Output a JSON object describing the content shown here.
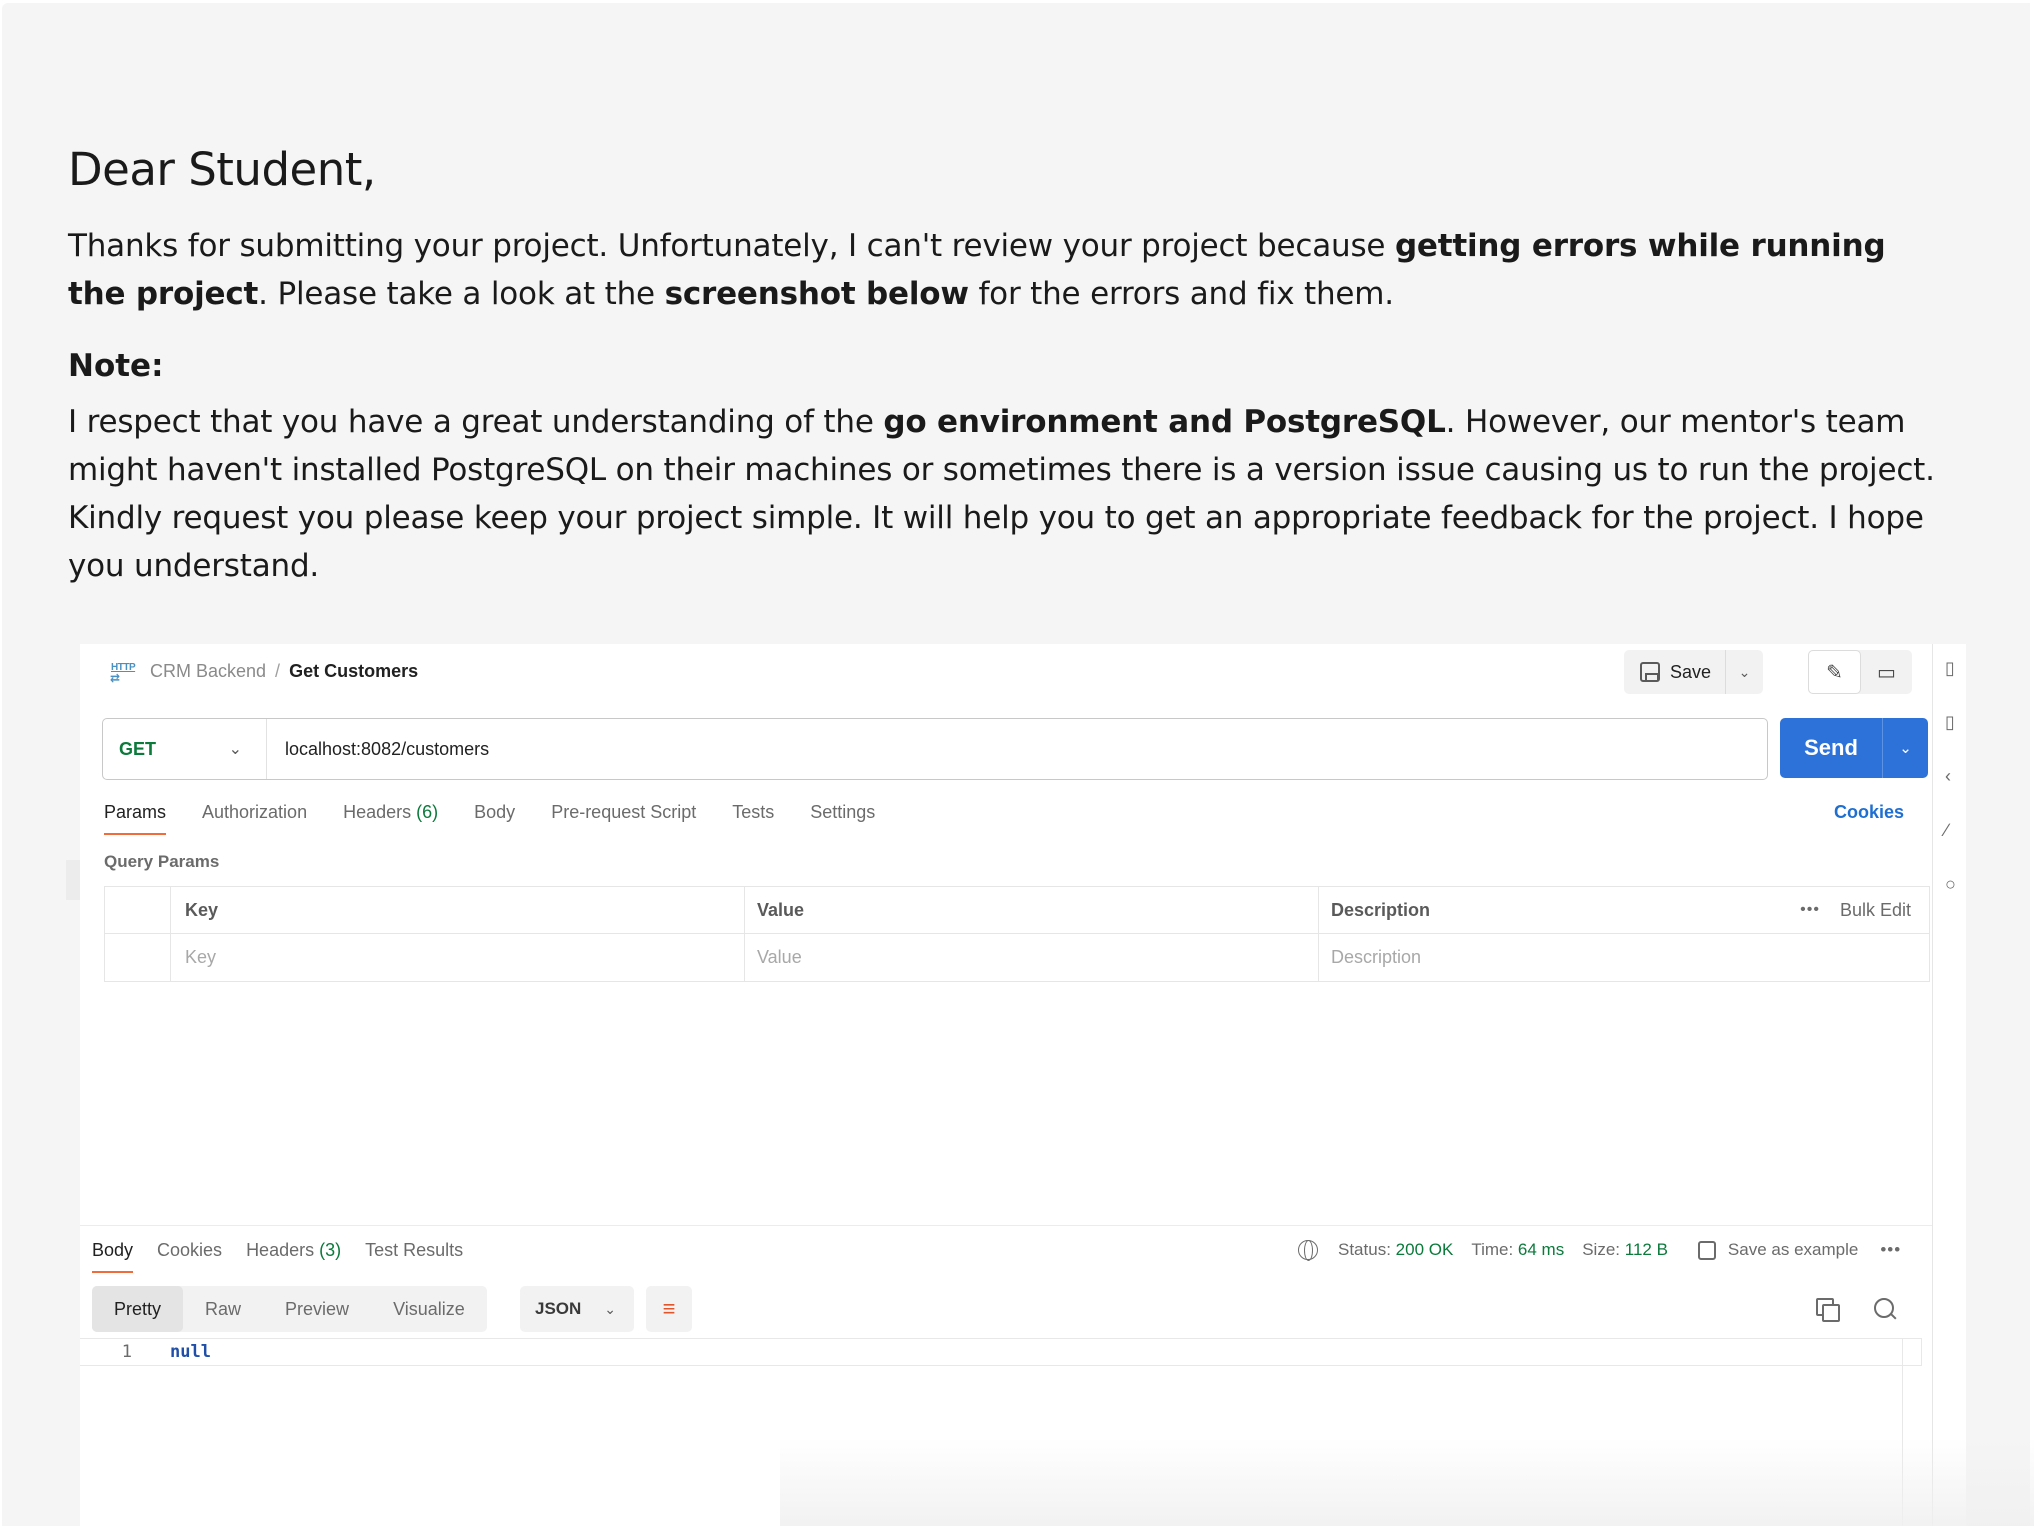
{
  "letter": {
    "greeting": "Dear Student,",
    "p1_a": "Thanks for submitting your project. Unfortunately, I can't review your project because ",
    "p1_b": "getting errors while running the project",
    "p1_c": ". Please take a look at the ",
    "p1_d": "screenshot below",
    "p1_e": " for the errors and fix them.",
    "note_heading": "Note:",
    "p2_a": "I respect that you have a great understanding of the ",
    "p2_b": "go environment and PostgreSQL",
    "p2_c": ". However, our mentor's team might haven't installed PostgreSQL on their machines or sometimes there is a version issue causing us to run the project. Kindly request you please keep your project simple. It will help you to get an appropriate feedback for the project. I hope you understand."
  },
  "postman": {
    "http_icon_label": "HTTP",
    "breadcrumb": {
      "parent": "CRM Backend",
      "separator": "/",
      "current": "Get Customers"
    },
    "save_label": "Save",
    "request": {
      "method": "GET",
      "url": "localhost:8082/customers",
      "send_label": "Send"
    },
    "request_tabs": [
      "Params",
      "Authorization",
      "Headers",
      "Body",
      "Pre-request Script",
      "Tests",
      "Settings"
    ],
    "headers_count": "(6)",
    "cookies_link": "Cookies",
    "query_params_label": "Query Params",
    "params_table": {
      "headers": {
        "key": "Key",
        "value": "Value",
        "description": "Description"
      },
      "bulk_edit": "Bulk Edit",
      "placeholder": {
        "key": "Key",
        "value": "Value",
        "description": "Description"
      }
    },
    "response_tabs": [
      "Body",
      "Cookies",
      "Headers",
      "Test Results"
    ],
    "response_headers_count": "(3)",
    "status_label": "Status:",
    "status_value": "200 OK",
    "time_label": "Time:",
    "time_value": "64 ms",
    "size_label": "Size:",
    "size_value": "112 B",
    "save_example_label": "Save as example",
    "view_modes": [
      "Pretty",
      "Raw",
      "Preview",
      "Visualize"
    ],
    "format": "JSON",
    "code": {
      "line_number": "1",
      "text": "null"
    }
  },
  "colors": {
    "accent_blue": "#2d72d9",
    "tab_underline": "#f26b3a",
    "success_green": "#0b7a3b"
  }
}
